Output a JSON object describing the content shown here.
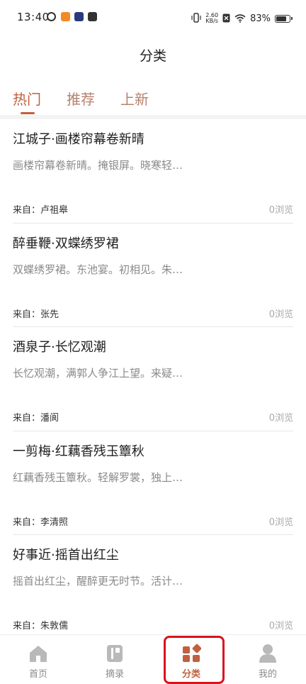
{
  "status_bar": {
    "time": "13:40",
    "net_speed_value": "2.60",
    "net_speed_unit": "KB/s",
    "battery_percent": "83%",
    "battery_level": 0.83
  },
  "page": {
    "title": "分类"
  },
  "tabs": [
    {
      "label": "热门",
      "active": true
    },
    {
      "label": "推荐",
      "active": false
    },
    {
      "label": "上新",
      "active": false
    }
  ],
  "feed": {
    "author_prefix": "来自：",
    "views_suffix": "浏览",
    "items": [
      {
        "title": "江城子·画楼帘幕卷新晴",
        "snippet": "画楼帘幕卷新晴。掩银屏。晓寒轻…",
        "author": "卢祖皋",
        "views": "0浏览"
      },
      {
        "title": "醉垂鞭·双蝶绣罗裙",
        "snippet": "双蝶绣罗裙。东池宴。初相见。朱…",
        "author": "张先",
        "views": "0浏览"
      },
      {
        "title": "酒泉子·长忆观潮",
        "snippet": "长忆观潮，满郭人争江上望。来疑…",
        "author": "潘阆",
        "views": "0浏览"
      },
      {
        "title": "一剪梅·红藕香残玉簟秋",
        "snippet": "红藕香残玉簟秋。轻解罗裳，独上…",
        "author": "李清照",
        "views": "0浏览"
      },
      {
        "title": "好事近·摇首出红尘",
        "snippet": "摇首出红尘，醒醉更无时节。活计…",
        "author": "朱敦儒",
        "views": "0浏览"
      }
    ]
  },
  "bottom_nav": [
    {
      "label": "首页",
      "icon": "home-icon",
      "active": false
    },
    {
      "label": "摘录",
      "icon": "excerpt-icon",
      "active": false
    },
    {
      "label": "分类",
      "icon": "category-icon",
      "active": true
    },
    {
      "label": "我的",
      "icon": "profile-icon",
      "active": false
    }
  ],
  "colors": {
    "accent": "#c0603f",
    "tab_inactive": "#b5826c",
    "icon_inactive": "#b9b9b9",
    "highlight_box": "#d8141c"
  }
}
